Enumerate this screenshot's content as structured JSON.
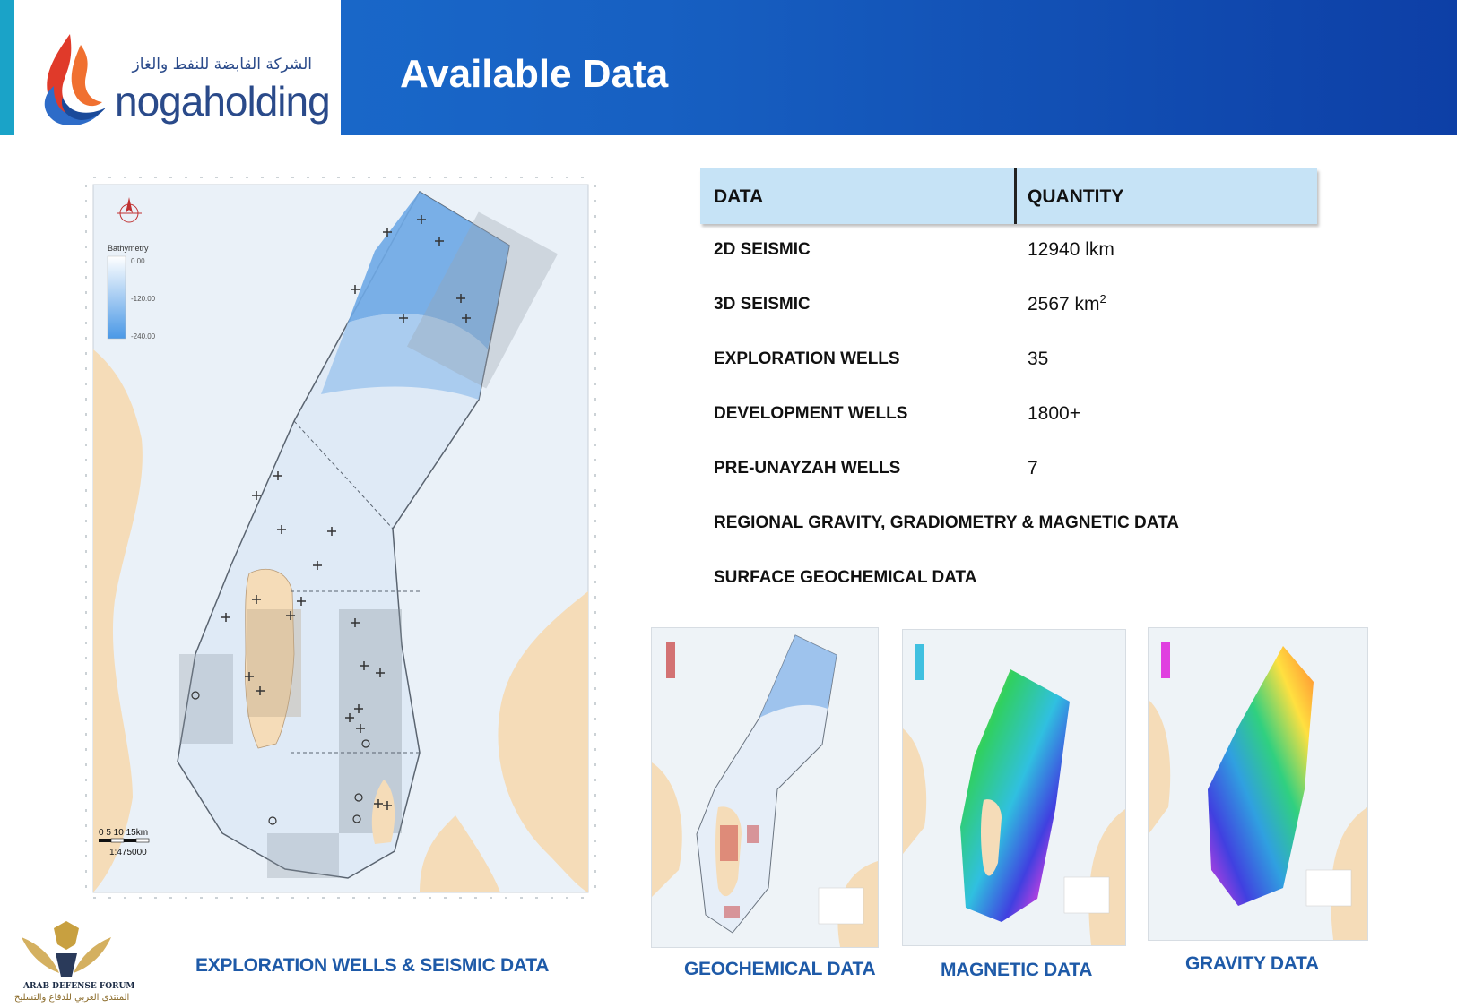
{
  "header": {
    "logo_text": "nogaholding",
    "logo_arabic": "الشركة القابضة للنفط والغاز",
    "title": "Available Data"
  },
  "table": {
    "headers": [
      "DATA",
      "QUANTITY"
    ],
    "rows": [
      {
        "label": "2D SEISMIC",
        "value": "12940 lkm"
      },
      {
        "label": "3D SEISMIC",
        "value": "2567 km",
        "value_sup": "2"
      },
      {
        "label": "EXPLORATION WELLS",
        "value": "35"
      },
      {
        "label": "DEVELOPMENT WELLS",
        "value": "1800+"
      },
      {
        "label": "PRE-UNAYZAH WELLS",
        "value": "7"
      },
      {
        "label": "REGIONAL GRAVITY, GRADIOMETRY & MAGNETIC DATA",
        "value": ""
      },
      {
        "label": "SURFACE GEOCHEMICAL DATA",
        "value": ""
      }
    ]
  },
  "main_map": {
    "legend_title": "Bathymetry",
    "legend_values": [
      "0.00",
      "-120.00",
      "-240.00"
    ],
    "scale_labels": "0   5   10   15km",
    "scale_ratio": "1:475000",
    "caption": "EXPLORATION WELLS & SEISMIC DATA"
  },
  "thumbnails": [
    {
      "caption": "GEOCHEMICAL DATA"
    },
    {
      "caption": "MAGNETIC DATA"
    },
    {
      "caption": "GRAVITY DATA"
    }
  ],
  "watermark": {
    "line1": "ARAB DEFENSE FORUM",
    "line2": "المنتدى العربي للدفاع والتسليح"
  },
  "colors": {
    "header_start": "#1b6fd0",
    "header_end": "#0d3fa6",
    "table_header": "#c6e3f6",
    "caption": "#1e5aa8",
    "land": "#f5dcb8",
    "sea": "#dfeaf6"
  }
}
